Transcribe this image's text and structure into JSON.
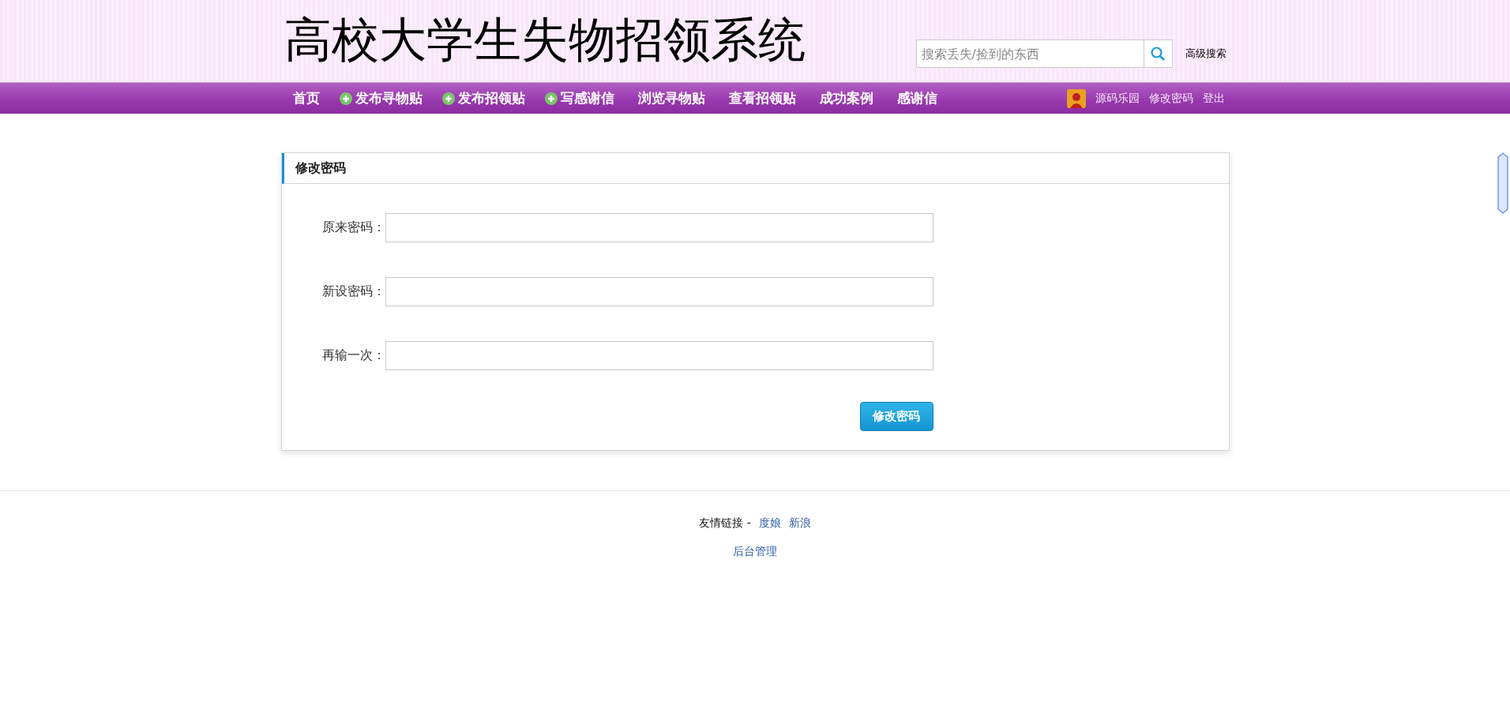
{
  "header": {
    "title": "高校大学生失物招领系统",
    "search": {
      "placeholder": "搜索丢失/捡到的东西"
    },
    "advanced_search": "高级搜索"
  },
  "nav": {
    "items": [
      {
        "label": "首页",
        "kind": "plain"
      },
      {
        "label": "发布寻物贴",
        "kind": "add"
      },
      {
        "label": "发布招领贴",
        "kind": "add"
      },
      {
        "label": "写感谢信",
        "kind": "add"
      },
      {
        "label": "浏览寻物贴",
        "kind": "plain"
      },
      {
        "label": "查看招领贴",
        "kind": "plain"
      },
      {
        "label": "成功案例",
        "kind": "plain"
      },
      {
        "label": "感谢信",
        "kind": "plain"
      }
    ],
    "user": {
      "name": "源码乐园",
      "links": [
        "修改密码",
        "登出"
      ]
    }
  },
  "card": {
    "title": "修改密码",
    "fields": [
      {
        "label": "原来密码："
      },
      {
        "label": "新设密码："
      },
      {
        "label": "再输一次："
      }
    ],
    "submit": "修改密码"
  },
  "footer": {
    "links_label": "友情链接 -",
    "links": [
      "度娘",
      "新浪"
    ],
    "admin": "后台管理"
  }
}
